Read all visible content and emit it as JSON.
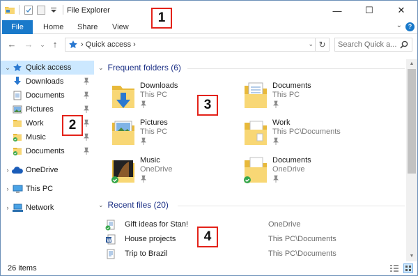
{
  "window": {
    "title": "File Explorer"
  },
  "window_controls": {
    "minimize": "—",
    "maximize": "☐",
    "close": "✕"
  },
  "ribbon": {
    "tabs": [
      "File",
      "Home",
      "Share",
      "View"
    ],
    "expand": "⌄",
    "help": "?"
  },
  "nav": {
    "back": "←",
    "forward": "→",
    "recent_dropdown": "⌄",
    "up": "↑"
  },
  "address": {
    "path": "› Quick access ›",
    "dropdown": "⌄",
    "refresh": "↻"
  },
  "search": {
    "placeholder": "Search Quick a..."
  },
  "navpane": {
    "items": [
      {
        "label": "Quick access",
        "icon": "star-icon",
        "pinned": false
      },
      {
        "label": "Downloads",
        "icon": "downloads-folder-icon",
        "pinned": true
      },
      {
        "label": "Documents",
        "icon": "documents-folder-icon",
        "pinned": true
      },
      {
        "label": "Pictures",
        "icon": "pictures-folder-icon",
        "pinned": true
      },
      {
        "label": "Work",
        "icon": "folder-icon",
        "pinned": true
      },
      {
        "label": "Music",
        "icon": "music-folder-icon",
        "pinned": true
      },
      {
        "label": "Documents",
        "icon": "onedrive-documents-folder-icon",
        "pinned": true
      },
      {
        "label": "OneDrive",
        "icon": "onedrive-cloud-icon",
        "pinned": false
      },
      {
        "label": "This PC",
        "icon": "computer-icon",
        "pinned": false
      },
      {
        "label": "Network",
        "icon": "network-icon",
        "pinned": false
      }
    ]
  },
  "frequent": {
    "header": "Frequent folders (6)",
    "folders": [
      {
        "name": "Downloads",
        "location": "This PC",
        "icon": "downloads-folder-icon"
      },
      {
        "name": "Documents",
        "location": "This PC",
        "icon": "documents-folder-icon"
      },
      {
        "name": "Pictures",
        "location": "This PC",
        "icon": "pictures-folder-icon"
      },
      {
        "name": "Work",
        "location": "This PC\\Documents",
        "icon": "work-folder-icon"
      },
      {
        "name": "Music",
        "location": "OneDrive",
        "icon": "music-folder-icon"
      },
      {
        "name": "Documents",
        "location": "OneDrive",
        "icon": "onedrive-documents-folder-icon"
      }
    ]
  },
  "recent": {
    "header": "Recent files (20)",
    "files": [
      {
        "name": "Gift ideas for Stan!",
        "location": "OneDrive",
        "icon": "onedrive-document-icon"
      },
      {
        "name": "House projects",
        "location": "This PC\\Documents",
        "icon": "word-document-icon"
      },
      {
        "name": "Trip to Brazil",
        "location": "This PC\\Documents",
        "icon": "document-icon"
      }
    ]
  },
  "statusbar": {
    "count": "26 items"
  },
  "callouts": [
    "1",
    "2",
    "3",
    "4"
  ],
  "colors": {
    "accent": "#1979ca",
    "selection": "#cce8ff",
    "group_header": "#1e3287",
    "callout_border": "#e32219",
    "folder": "#f8d775"
  }
}
